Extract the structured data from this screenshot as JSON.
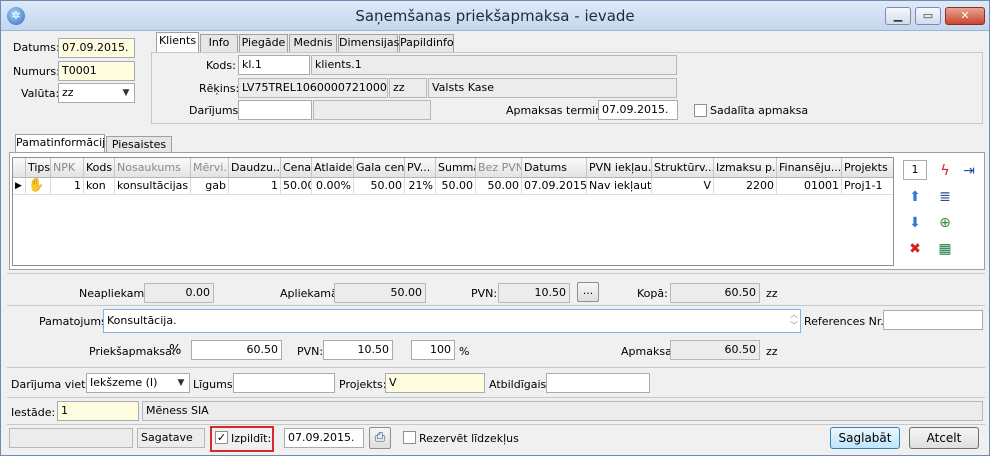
{
  "window": {
    "title": "Saņemšanas priekšapmaksa - ievade",
    "min": "▁",
    "max": "▭",
    "close": "✕"
  },
  "header": {
    "datums_label": "Datums:",
    "datums_value": "07.09.2015.",
    "numurs_label": "Numurs:",
    "numurs_value": "T0001",
    "valuta_label": "Valūta:",
    "valuta_value": "zz"
  },
  "top_tabs": [
    "Klients",
    "Info",
    "Piegāde",
    "Mednis",
    "Dimensijas",
    "Papildinfo"
  ],
  "client": {
    "kods_label": "Kods:",
    "kods_value": "kl.1",
    "kods_name": "klients.1",
    "rekins_label": "Rēķins:",
    "rekins_value": "LV75TREL1060000721000",
    "rekins_cur": "zz",
    "rekins_bank": "Valsts Kase",
    "darijums_label": "Darījums:",
    "darijums_value": "",
    "darijums_extra": "",
    "termins_label": "Apmaksas termiņš:",
    "termins_value": "07.09.2015.",
    "sadalita_label": "Sadalīta apmaksa"
  },
  "main_tabs": [
    "Pamatinformācija",
    "Piesaistes"
  ],
  "grid": {
    "columns": [
      "Tips",
      "NPK",
      "Kods",
      "Nosaukums",
      "Mērvi...",
      "Daudzu...",
      "Cena",
      "Atlaide",
      "Gala cena",
      "PV...",
      "Summa",
      "Bez PVN",
      "Datums",
      "PVN iekļau...",
      "Struktūrv...",
      "Izmaksu p...",
      "Finansēju...",
      "Projekts"
    ],
    "row": {
      "marker": "▶",
      "tips_icon": "✋",
      "npk": "1",
      "kods": "kon",
      "nosaukums": "konsultācijas",
      "mervieniba": "gab",
      "daudzums": "1",
      "cena": "50.00",
      "atlaide": "0.00%",
      "gala_cena": "50.00",
      "pvn": "21%",
      "summa": "50.00",
      "bez_pvn": "50.00",
      "datums": "07.09.2015.",
      "pvn_ieklauts": "Nav iekļauts",
      "strukturvieniba": "V",
      "izmaksu_p": "2200",
      "finansejums": "01001",
      "projekts": "Proj1-1"
    }
  },
  "side_tools": {
    "counter": "1",
    "icons": [
      "lightning-icon",
      "insert-row-icon",
      "up-arrow-icon",
      "list-arrow-icon",
      "down-arrow-icon",
      "search-add-icon",
      "delete-icon",
      "excel-icon"
    ]
  },
  "totals": {
    "neapliekama_label": "Neapliekamā:",
    "neapliekama_value": "0.00",
    "apliekama_label": "Apliekamā:",
    "apliekama_value": "50.00",
    "pvn_label": "PVN:",
    "pvn_value": "10.50",
    "pvn_btn": "...",
    "kopa_label": "Kopā:",
    "kopa_value": "60.50",
    "kopa_cur": "zz"
  },
  "pamatojums": {
    "label": "Pamatojums:",
    "value": "Konsultācija.",
    "ref_label": "References Nr.:",
    "ref_value": ""
  },
  "prepay": {
    "label": "Priekšapmaksa:",
    "pct_sign": "%",
    "value": "60.50",
    "pvn_label": "PVN:",
    "pvn_value": "10.50",
    "pct_value": "100",
    "pct_suffix": "%",
    "apmaksai_label": "Apmaksai:",
    "apmaksai_value": "60.50",
    "apmaksai_cur": "zz"
  },
  "details": {
    "vieta_label": "Darījuma vieta:",
    "vieta_value": "Iekšzeme (I)",
    "ligums_label": "Līgums:",
    "ligums_value": "",
    "projekts_label": "Projekts:",
    "projekts_value": "V",
    "atbildigais_label": "Atbildīgais:",
    "atbildigais_value": ""
  },
  "iestade": {
    "label": "Iestāde:",
    "value": "1",
    "name": "Mēness SIA"
  },
  "footer": {
    "status_empty": "",
    "status": "Sagatave",
    "izpildit_label": "Izpildīt:",
    "izpildit_checked": "✓",
    "izpildit_date": "07.09.2015.",
    "rezervet_label": "Rezervēt līdzekļus",
    "save": "Saglabāt",
    "cancel": "Atcelt"
  },
  "colors": {
    "highlight_box": "#d9282f",
    "yellow_field": "#fffde0",
    "primary_button": "#bee6fd"
  }
}
